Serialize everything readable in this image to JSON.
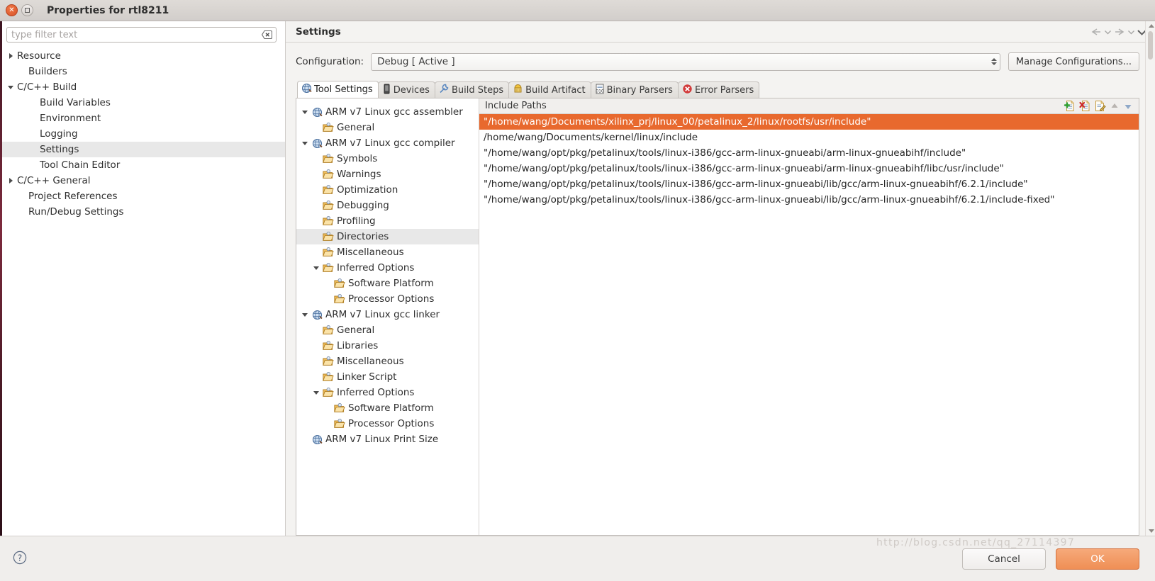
{
  "window": {
    "title": "Properties for rtl8211",
    "close_label": "×",
    "maximize_label": ""
  },
  "sidebar": {
    "filter": {
      "value": "",
      "placeholder": "type filter text"
    },
    "items": [
      {
        "label": "Resource",
        "indent": 0,
        "twisty": "right",
        "selected": false
      },
      {
        "label": "Builders",
        "indent": 1,
        "twisty": "none",
        "selected": false
      },
      {
        "label": "C/C++ Build",
        "indent": 0,
        "twisty": "down",
        "selected": false
      },
      {
        "label": "Build Variables",
        "indent": 2,
        "twisty": "none",
        "selected": false
      },
      {
        "label": "Environment",
        "indent": 2,
        "twisty": "none",
        "selected": false
      },
      {
        "label": "Logging",
        "indent": 2,
        "twisty": "none",
        "selected": false
      },
      {
        "label": "Settings",
        "indent": 2,
        "twisty": "none",
        "selected": true
      },
      {
        "label": "Tool Chain Editor",
        "indent": 2,
        "twisty": "none",
        "selected": false
      },
      {
        "label": "C/C++ General",
        "indent": 0,
        "twisty": "right",
        "selected": false
      },
      {
        "label": "Project References",
        "indent": 1,
        "twisty": "none",
        "selected": false
      },
      {
        "label": "Run/Debug Settings",
        "indent": 1,
        "twisty": "none",
        "selected": false
      }
    ]
  },
  "page": {
    "title": "Settings",
    "nav": [
      {
        "name": "back-arrow-icon"
      },
      {
        "name": "back-dropdown-icon"
      },
      {
        "name": "forward-arrow-icon"
      },
      {
        "name": "forward-dropdown-icon"
      },
      {
        "name": "menu-dropdown-icon"
      }
    ]
  },
  "configuration": {
    "label": "Configuration:",
    "value": "Debug  [ Active ]",
    "manage_button": "Manage Configurations..."
  },
  "tabs": [
    {
      "label": "Tool Settings",
      "icon": "globe-icon",
      "active": true
    },
    {
      "label": "Devices",
      "icon": "device-icon",
      "active": false
    },
    {
      "label": "Build Steps",
      "icon": "wrench-icon",
      "active": false
    },
    {
      "label": "Build Artifact",
      "icon": "artifact-icon",
      "active": false
    },
    {
      "label": "Binary Parsers",
      "icon": "binary-icon",
      "active": false
    },
    {
      "label": "Error Parsers",
      "icon": "error-icon",
      "active": false
    }
  ],
  "tool_tree": [
    {
      "label": "ARM v7 Linux gcc assembler",
      "indent": 0,
      "twisty": "down",
      "icon": "globe-icon",
      "selected": false
    },
    {
      "label": "General",
      "indent": 1,
      "twisty": "none",
      "icon": "folder-icon",
      "selected": false
    },
    {
      "label": "ARM v7 Linux gcc compiler",
      "indent": 0,
      "twisty": "down",
      "icon": "globe-icon",
      "selected": false
    },
    {
      "label": "Symbols",
      "indent": 1,
      "twisty": "none",
      "icon": "folder-icon",
      "selected": false
    },
    {
      "label": "Warnings",
      "indent": 1,
      "twisty": "none",
      "icon": "folder-icon",
      "selected": false
    },
    {
      "label": "Optimization",
      "indent": 1,
      "twisty": "none",
      "icon": "folder-icon",
      "selected": false
    },
    {
      "label": "Debugging",
      "indent": 1,
      "twisty": "none",
      "icon": "folder-icon",
      "selected": false
    },
    {
      "label": "Profiling",
      "indent": 1,
      "twisty": "none",
      "icon": "folder-icon",
      "selected": false
    },
    {
      "label": "Directories",
      "indent": 1,
      "twisty": "none",
      "icon": "folder-icon",
      "selected": true
    },
    {
      "label": "Miscellaneous",
      "indent": 1,
      "twisty": "none",
      "icon": "folder-icon",
      "selected": false
    },
    {
      "label": "Inferred Options",
      "indent": 1,
      "twisty": "down",
      "icon": "folder-icon",
      "selected": false
    },
    {
      "label": "Software Platform",
      "indent": 2,
      "twisty": "none",
      "icon": "folder-icon",
      "selected": false
    },
    {
      "label": "Processor Options",
      "indent": 2,
      "twisty": "none",
      "icon": "folder-icon",
      "selected": false
    },
    {
      "label": "ARM v7 Linux gcc linker",
      "indent": 0,
      "twisty": "down",
      "icon": "globe-icon",
      "selected": false
    },
    {
      "label": "General",
      "indent": 1,
      "twisty": "none",
      "icon": "folder-icon",
      "selected": false
    },
    {
      "label": "Libraries",
      "indent": 1,
      "twisty": "none",
      "icon": "folder-icon",
      "selected": false
    },
    {
      "label": "Miscellaneous",
      "indent": 1,
      "twisty": "none",
      "icon": "folder-icon",
      "selected": false
    },
    {
      "label": "Linker Script",
      "indent": 1,
      "twisty": "none",
      "icon": "folder-icon",
      "selected": false
    },
    {
      "label": "Inferred Options",
      "indent": 1,
      "twisty": "down",
      "icon": "folder-icon",
      "selected": false
    },
    {
      "label": "Software Platform",
      "indent": 2,
      "twisty": "none",
      "icon": "folder-icon",
      "selected": false
    },
    {
      "label": "Processor Options",
      "indent": 2,
      "twisty": "none",
      "icon": "folder-icon",
      "selected": false
    },
    {
      "label": "ARM v7 Linux Print Size",
      "indent": 0,
      "twisty": "none",
      "icon": "globe-icon",
      "selected": false
    }
  ],
  "include_paths": {
    "header": "Include Paths",
    "toolbar": [
      {
        "name": "add-path-icon"
      },
      {
        "name": "delete-path-icon"
      },
      {
        "name": "edit-path-icon"
      },
      {
        "name": "move-up-icon"
      },
      {
        "name": "move-down-icon"
      }
    ],
    "rows": [
      {
        "value": "\"/home/wang/Documents/xilinx_prj/linux_00/petalinux_2/linux/rootfs/usr/include\"",
        "selected": true
      },
      {
        "value": "/home/wang/Documents/kernel/linux/include",
        "selected": false
      },
      {
        "value": "\"/home/wang/opt/pkg/petalinux/tools/linux-i386/gcc-arm-linux-gnueabi/arm-linux-gnueabihf/include\"",
        "selected": false
      },
      {
        "value": "\"/home/wang/opt/pkg/petalinux/tools/linux-i386/gcc-arm-linux-gnueabi/arm-linux-gnueabihf/libc/usr/include\"",
        "selected": false
      },
      {
        "value": "\"/home/wang/opt/pkg/petalinux/tools/linux-i386/gcc-arm-linux-gnueabi/lib/gcc/arm-linux-gnueabihf/6.2.1/include\"",
        "selected": false
      },
      {
        "value": "\"/home/wang/opt/pkg/petalinux/tools/linux-i386/gcc-arm-linux-gnueabi/lib/gcc/arm-linux-gnueabihf/6.2.1/include-fixed\"",
        "selected": false
      }
    ]
  },
  "footer": {
    "help_icon": "help-icon",
    "cancel_label": "Cancel",
    "ok_label": "OK"
  },
  "watermark": "http://blog.csdn.net/qq_27114397",
  "colors": {
    "selection_orange": "#e8692e",
    "ok_button": "#ef8f55",
    "tree_selection": "#e8e8e8"
  }
}
